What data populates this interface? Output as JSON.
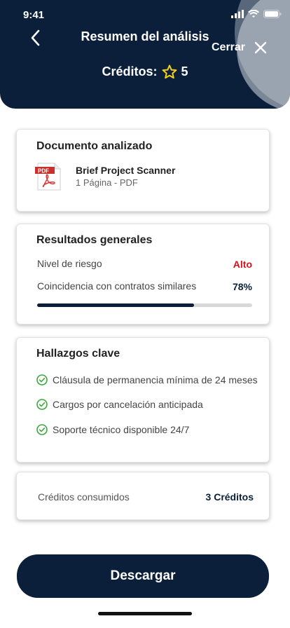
{
  "status_bar": {
    "time": "9:41"
  },
  "header": {
    "title": "Resumen del análisis",
    "close_label": "Cerrar",
    "credits_label": "Créditos:",
    "credits_value": "5"
  },
  "document_card": {
    "title": "Documento analizado",
    "file_icon_text": "PDF",
    "file_name": "Brief Project Scanner",
    "file_meta": "1 Página - PDF"
  },
  "results_card": {
    "title": "Resultados generales",
    "risk_label": "Nivel de riesgo",
    "risk_value": "Alto",
    "match_label": "Coincidencia con contratos similares",
    "match_value": "78%",
    "match_fraction": 0.73
  },
  "findings_card": {
    "title": "Hallazgos clave",
    "items": [
      "Cláusula de permanencia mínima de 24 meses",
      "Cargos por cancelación anticipada",
      "Soporte técnico disponible 24/7"
    ]
  },
  "consumed_card": {
    "label": "Créditos consumidos",
    "value": "3 Créditos"
  },
  "download_button": {
    "label": "Descargar"
  },
  "colors": {
    "navy": "#0b1f3b",
    "risk_red": "#d0121b",
    "check_green": "#3aa83a",
    "star_yellow": "#f4d017"
  }
}
